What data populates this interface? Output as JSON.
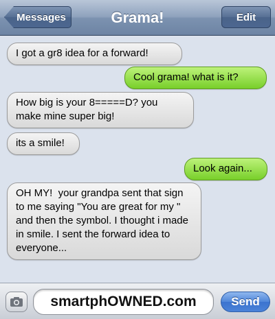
{
  "navbar": {
    "back_label": "Messages",
    "title": "Grama!",
    "edit_label": "Edit"
  },
  "messages": [
    {
      "sender": "contact",
      "text": "I got a gr8 idea for a forward!"
    },
    {
      "sender": "me",
      "text": "Cool grama! what is it?"
    },
    {
      "sender": "contact",
      "text": "How big is your 8=====D? you make mine super big!"
    },
    {
      "sender": "contact",
      "text": "its a smile!"
    },
    {
      "sender": "me",
      "text": "Look again..."
    },
    {
      "sender": "contact",
      "text": "OH MY!  your grandpa sent that sign to me saying \"You are great for my \" and then the symbol. I thought i made in smile. I sent the forward idea to everyone..."
    }
  ],
  "inputbar": {
    "camera_icon": "camera-icon",
    "field_text": "smartphOWNED.com",
    "send_label": "Send"
  },
  "colors": {
    "outgoing_bubble": "#8fdc3f",
    "incoming_bubble": "#e6e6e6",
    "background": "#dbe2ed",
    "nav_bar": "#8ea2bd",
    "send_button": "#4a82d8"
  }
}
